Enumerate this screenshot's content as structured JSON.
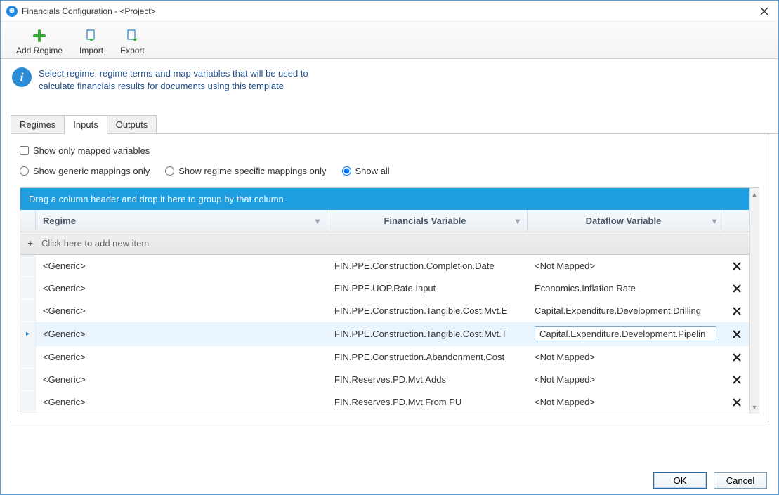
{
  "window": {
    "title": "Financials Configuration - <Project>"
  },
  "toolbar": {
    "add_regime": "Add Regime",
    "import": "Import",
    "export": "Export"
  },
  "info": {
    "line1": "Select regime, regime terms and map variables that will be used to",
    "line2": "calculate financials results for documents using this template"
  },
  "tabs": {
    "regimes": "Regimes",
    "inputs": "Inputs",
    "outputs": "Outputs"
  },
  "filters": {
    "show_only_mapped": "Show only mapped variables",
    "generic_only": "Show generic mappings only",
    "regime_only": "Show regime specific mappings only",
    "show_all": "Show all"
  },
  "grid": {
    "group_hint": "Drag a column header and drop it here to group by that column",
    "cols": {
      "regime": "Regime",
      "fin": "Financials Variable",
      "df": "Dataflow Variable"
    },
    "new_row": "Click here to add new item",
    "rows": [
      {
        "regime": "<Generic>",
        "fin": "FIN.PPE.Construction.Completion.Date",
        "df": "<Not Mapped>"
      },
      {
        "regime": "<Generic>",
        "fin": "FIN.PPE.UOP.Rate.Input",
        "df": "Economics.Inflation Rate"
      },
      {
        "regime": "<Generic>",
        "fin": "FIN.PPE.Construction.Tangible.Cost.Mvt.E",
        "df": "Capital.Expenditure.Development.Drilling"
      },
      {
        "regime": "<Generic>",
        "fin": "FIN.PPE.Construction.Tangible.Cost.Mvt.T",
        "df": "Capital.Expenditure.Development.Pipelin",
        "selected": true
      },
      {
        "regime": "<Generic>",
        "fin": "FIN.PPE.Construction.Abandonment.Cost",
        "df": "<Not Mapped>"
      },
      {
        "regime": "<Generic>",
        "fin": "FIN.Reserves.PD.Mvt.Adds",
        "df": "<Not Mapped>"
      },
      {
        "regime": "<Generic>",
        "fin": "FIN.Reserves.PD.Mvt.From PU",
        "df": "<Not Mapped>"
      }
    ]
  },
  "buttons": {
    "ok": "OK",
    "cancel": "Cancel"
  }
}
